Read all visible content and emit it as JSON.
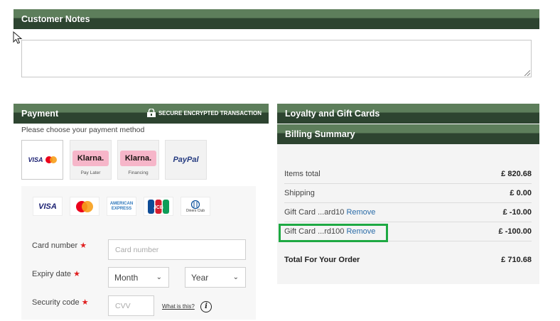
{
  "customer_notes": {
    "title": "Customer Notes",
    "value": ""
  },
  "payment": {
    "title": "Payment",
    "secure_label": "SECURE ENCRYPTED TRANSACTION",
    "choose_label": "Please choose your payment method",
    "methods": [
      {
        "label": "VISA",
        "sublabel": "",
        "selected": true
      },
      {
        "label": "Klarna.",
        "sublabel": "Pay Later"
      },
      {
        "label": "Klarna.",
        "sublabel": "Financing"
      },
      {
        "label": "PayPal",
        "sublabel": ""
      }
    ],
    "card_brands": [
      {
        "label": "VISA",
        "icon": "visa-icon"
      },
      {
        "label": "",
        "icon": "mastercard-icon"
      },
      {
        "label": "AMERICAN EXPRESS",
        "icon": "amex-icon"
      },
      {
        "label": "JCB",
        "icon": "jcb-icon"
      },
      {
        "label": "Diners Club",
        "icon": "diners-club-icon"
      }
    ],
    "card_number": {
      "label": "Card number",
      "placeholder": "Card number"
    },
    "expiry": {
      "label": "Expiry date",
      "month": "Month",
      "year": "Year"
    },
    "security": {
      "label": "Security code",
      "placeholder": "CVV",
      "help": "What is this?"
    },
    "required_mark": "★"
  },
  "loyalty": {
    "title": "Loyalty and Gift Cards"
  },
  "billing": {
    "title": "Billing Summary",
    "rows": [
      {
        "label": "Items total",
        "amount": "£ 820.68"
      },
      {
        "label": "Shipping",
        "amount": "£ 0.00"
      },
      {
        "label": "Gift Card ...ard10",
        "link": "Remove",
        "amount": "£ -10.00"
      },
      {
        "label": "Gift Card ...rd100",
        "link": "Remove",
        "amount": "£ -100.00"
      }
    ],
    "total": {
      "label": "Total For Your Order",
      "amount": "£ 710.68"
    }
  },
  "colors": {
    "header_light": "#5d7e5b",
    "header_dark": "#2d4430",
    "highlight": "#1ea943",
    "link": "#2a6ca8"
  }
}
